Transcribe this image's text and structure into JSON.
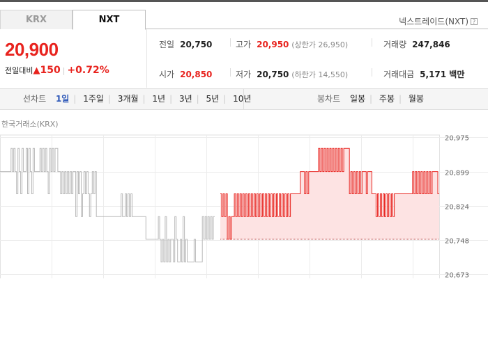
{
  "tabs": [
    {
      "label": "KRX",
      "selected": false
    },
    {
      "label": "NXT",
      "selected": true
    }
  ],
  "market_label": "넥스트레이드(NXT)",
  "help_icon": "?",
  "price": {
    "current": "20,900",
    "change_label": "전일대비",
    "change_arrow": "▲",
    "change_value": "150",
    "change_percent": "+0.72%"
  },
  "info": {
    "prev_close": {
      "label": "전일",
      "value": "20,750"
    },
    "high": {
      "label": "고가",
      "value": "20,950",
      "limit": "(상한가 26,950)"
    },
    "volume": {
      "label": "거래량",
      "value": "247,846"
    },
    "open": {
      "label": "시가",
      "value": "20,850"
    },
    "low": {
      "label": "저가",
      "value": "20,750",
      "limit": "(하한가 14,550)"
    },
    "amount": {
      "label": "거래대금",
      "value": "5,171 백만"
    }
  },
  "line_chart_toolbar": {
    "label": "선차트",
    "options": [
      "1일",
      "1주일",
      "3개월",
      "1년",
      "3년",
      "5년",
      "10년"
    ],
    "selected": "1일"
  },
  "candle_chart_toolbar": {
    "label": "봉차트",
    "options": [
      "일봉",
      "주봉",
      "월봉"
    ]
  },
  "exchange_label": "한국거래소(KRX)",
  "colors": {
    "up": "#e8231e",
    "selected": "#2c57b8",
    "gray_line": "#b8b8b8",
    "red_fill": "#fde3e3"
  },
  "chart_data": {
    "type": "line",
    "y_ticks": [
      "20,975",
      "20,899",
      "20,824",
      "20,748",
      "20,673"
    ],
    "ylim": [
      20673,
      20975
    ],
    "reference_value": 20750,
    "series": [
      {
        "segment": "krx",
        "values": [
          20899,
          20899,
          20899,
          20899,
          20899,
          20899,
          20899,
          20899,
          20950,
          20899,
          20950,
          20899,
          20850,
          20950,
          20899,
          20850,
          20950,
          20899,
          20899,
          20950,
          20850,
          20950,
          20899,
          20850,
          20950,
          20899,
          20899,
          20899,
          20899,
          20950,
          20899,
          20950,
          20899,
          20950,
          20899,
          20850,
          20950,
          20899,
          20950,
          20899,
          20950,
          20950,
          20899,
          20899,
          20850,
          20899,
          20850,
          20899,
          20850,
          20899,
          20850,
          20899,
          20850,
          20899,
          20899,
          20800,
          20899,
          20850,
          20899,
          20800,
          20850,
          20899,
          20850,
          20899,
          20850,
          20800,
          20850,
          20899,
          20850,
          20899,
          20800,
          20800,
          20800,
          20800,
          20800,
          20800,
          20800,
          20800,
          20800,
          20800,
          20800,
          20800,
          20800,
          20800,
          20800,
          20800,
          20800,
          20800,
          20850,
          20800,
          20800,
          20850,
          20800,
          20850,
          20800,
          20850,
          20800,
          20800,
          20800,
          20800,
          20800,
          20800,
          20800,
          20800,
          20800,
          20800,
          20750,
          20750,
          20750,
          20750,
          20750,
          20750,
          20750,
          20750,
          20750,
          20800,
          20750,
          20700,
          20750,
          20700,
          20800,
          20700,
          20750,
          20700,
          20750,
          20750,
          20700,
          20800,
          20750,
          20700,
          20700,
          20750,
          20700,
          20800,
          20700,
          20750,
          20700,
          20700,
          20700,
          20700,
          20700,
          20750,
          20700,
          20700,
          20700,
          20700,
          20700,
          20800,
          20750,
          20800,
          20750,
          20800,
          20750,
          20800,
          20750,
          20800,
          20800
        ]
      },
      {
        "segment": "nxt",
        "values": [
          20850,
          20800,
          20850,
          20800,
          20850,
          20750,
          20800,
          20750,
          20800,
          20800,
          20850,
          20800,
          20850,
          20800,
          20850,
          20800,
          20850,
          20800,
          20850,
          20800,
          20850,
          20800,
          20850,
          20800,
          20850,
          20800,
          20850,
          20800,
          20850,
          20800,
          20850,
          20800,
          20850,
          20800,
          20850,
          20800,
          20850,
          20800,
          20850,
          20800,
          20850,
          20800,
          20850,
          20800,
          20850,
          20800,
          20850,
          20800,
          20850,
          20800,
          20850,
          20850,
          20850,
          20850,
          20850,
          20850,
          20850,
          20899,
          20899,
          20899,
          20850,
          20899,
          20850,
          20899,
          20899,
          20899,
          20899,
          20899,
          20899,
          20899,
          20950,
          20899,
          20950,
          20899,
          20950,
          20899,
          20950,
          20899,
          20950,
          20899,
          20950,
          20899,
          20950,
          20899,
          20950,
          20899,
          20950,
          20899,
          20950,
          20950,
          20950,
          20950,
          20850,
          20899,
          20850,
          20899,
          20850,
          20899,
          20850,
          20899,
          20850,
          20899,
          20899,
          20899,
          20850,
          20899,
          20899,
          20899,
          20850,
          20850,
          20850,
          20800,
          20850,
          20800,
          20850,
          20800,
          20850,
          20800,
          20850,
          20800,
          20850,
          20800,
          20850,
          20800,
          20850,
          20850,
          20850,
          20850,
          20850,
          20850,
          20850,
          20850,
          20850,
          20850,
          20850,
          20850,
          20850,
          20899,
          20850,
          20899,
          20850,
          20899,
          20850,
          20899,
          20850,
          20899,
          20850,
          20899,
          20850,
          20899,
          20850,
          20899,
          20899,
          20899,
          20899,
          20850,
          20850
        ]
      }
    ]
  }
}
